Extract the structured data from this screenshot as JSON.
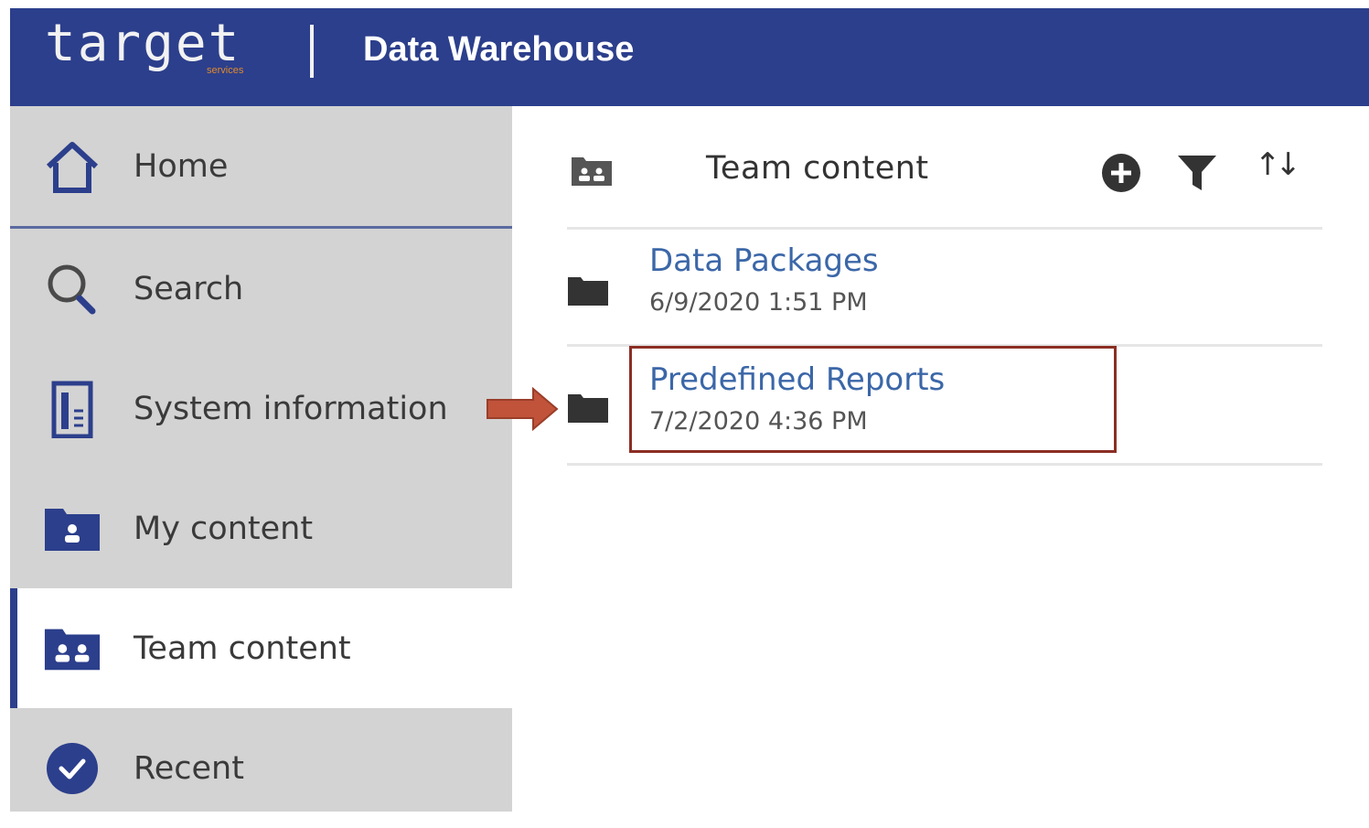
{
  "header": {
    "logo_text": "target",
    "logo_sub": "services",
    "app_title": "Data Warehouse",
    "bg_color": "#2c3f8c",
    "logo_accent_color": "#e08a2c"
  },
  "sidebar": {
    "items": [
      {
        "label": "Home",
        "icon": "home-icon"
      },
      {
        "label": "Search",
        "icon": "search-icon"
      },
      {
        "label": "System information",
        "icon": "system-info-icon"
      },
      {
        "label": "My content",
        "icon": "my-content-folder-icon"
      },
      {
        "label": "Team content",
        "icon": "team-content-folder-icon",
        "active": true
      },
      {
        "label": "Recent",
        "icon": "recent-check-icon"
      }
    ]
  },
  "content": {
    "title": "Team content",
    "actions": [
      "add-icon",
      "filter-icon",
      "sort-icon"
    ],
    "rows": [
      {
        "name": "Data Packages",
        "date": "6/9/2020 1:51 PM"
      },
      {
        "name": "Predefined Reports",
        "date": "7/2/2020 4:36 PM",
        "highlighted": true
      }
    ]
  },
  "annotation": {
    "arrow_color": "#c0533a",
    "box_color": "#8b2e24"
  }
}
